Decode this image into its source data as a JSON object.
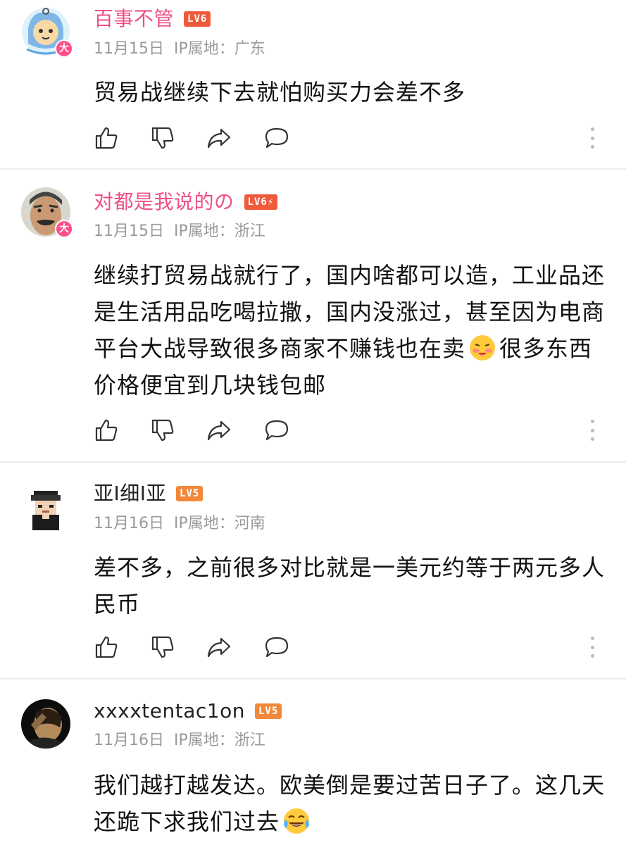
{
  "colors": {
    "vip_name": "#f04f86",
    "lv_badge_red": "#ef5a3a",
    "lv_badge_orange": "#f2883a",
    "meta_gray": "#9a9a9a"
  },
  "icons": [
    "thumbs-up-icon",
    "thumbs-down-icon",
    "share-icon",
    "reply-icon",
    "more-icon"
  ],
  "comments": [
    {
      "username": "百事不管",
      "level": "LV6",
      "date": "11月15日",
      "ip": "IP属地：广东",
      "avatar_badge": "大",
      "content": "贸易战继续下去就怕购买力会差不多"
    },
    {
      "username": "对都是我说的の",
      "level": "LV6⚡",
      "date": "11月15日",
      "ip": "IP属地：浙江",
      "avatar_badge": "大",
      "content_part1": "继续打贸易战就行了，国内啥都可以造，工业品还是生活用品吃喝拉撒，国内没涨过，甚至因为电商平台大战导致很多商家不赚钱也在卖",
      "content_part2": "很多东西价格便宜到几块钱包邮",
      "emoji": "hot-face-emoji"
    },
    {
      "username": "亚I细I亚",
      "level": "LV5",
      "date": "11月16日",
      "ip": "IP属地：河南",
      "content": "差不多，之前很多对比就是一美元约等于两元多人民币"
    },
    {
      "username": "xxxxtentac1on",
      "level": "LV5",
      "date": "11月16日",
      "ip": "IP属地：浙江",
      "content": "我们越打越发达。欧美倒是要过苦日子了。这几天还跪下求我们过去",
      "emoji": "laughing-tears-emoji"
    }
  ]
}
